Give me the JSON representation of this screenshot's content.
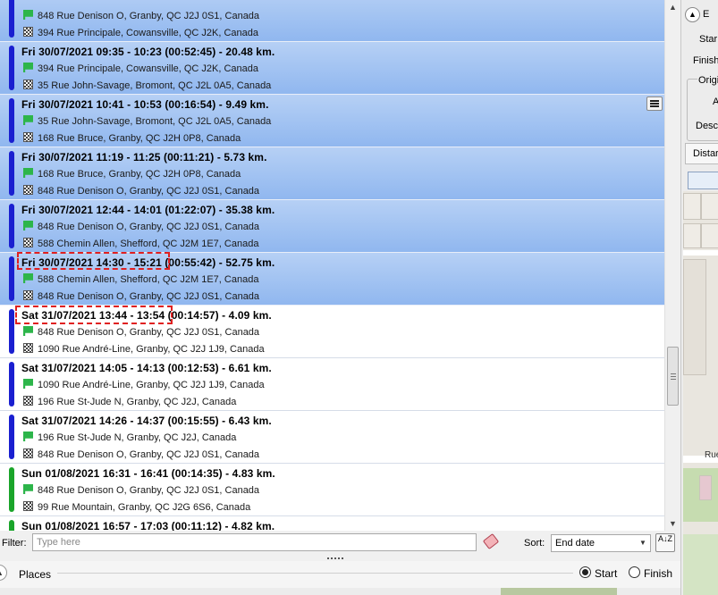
{
  "trips": [
    {
      "title": "",
      "from": "848 Rue Denison O, Granby, QC J2J 0S1, Canada",
      "to": "394 Rue Principale, Cowansville, QC J2K, Canada",
      "bar_color": "#1a1fd0",
      "selected": true
    },
    {
      "title": "Fri 30/07/2021  09:35 - 10:23  (00:52:45) - 20.48 km.",
      "from": "394 Rue Principale, Cowansville, QC J2K, Canada",
      "to": "35 Rue John-Savage, Bromont, QC J2L 0A5, Canada",
      "bar_color": "#1a1fd0",
      "selected": true
    },
    {
      "title": "Fri 30/07/2021  10:41 - 10:53  (00:16:54) - 9.49 km.",
      "from": "35 Rue John-Savage, Bromont, QC J2L 0A5, Canada",
      "to": "168 Rue Bruce, Granby, QC J2H 0P8, Canada",
      "bar_color": "#1a1fd0",
      "selected": true
    },
    {
      "title": "Fri 30/07/2021  11:19 - 11:25  (00:11:21) - 5.73 km.",
      "from": "168 Rue Bruce, Granby, QC J2H 0P8, Canada",
      "to": "848 Rue Denison O, Granby, QC J2J 0S1, Canada",
      "bar_color": "#1a1fd0",
      "selected": true
    },
    {
      "title": "Fri 30/07/2021  12:44 - 14:01  (01:22:07) - 35.38 km.",
      "from": "848 Rue Denison O, Granby, QC J2J 0S1, Canada",
      "to": "588 Chemin Allen, Shefford, QC J2M 1E7, Canada",
      "bar_color": "#1a1fd0",
      "selected": true
    },
    {
      "title": "Fri 30/07/2021  14:30 - 15:21  (00:55:42) - 52.75 km.",
      "from": "588 Chemin Allen, Shefford, QC J2M 1E7, Canada",
      "to": "848 Rue Denison O, Granby, QC J2J 0S1, Canada",
      "bar_color": "#1a1fd0",
      "selected": true
    },
    {
      "title": "Sat 31/07/2021  13:44 - 13:54  (00:14:57) - 4.09 km.",
      "from": "848 Rue Denison O, Granby, QC J2J 0S1, Canada",
      "to": "1090 Rue André-Line, Granby, QC J2J 1J9, Canada",
      "bar_color": "#1a1fd0",
      "selected": false
    },
    {
      "title": "Sat 31/07/2021  14:05 - 14:13  (00:12:53) - 6.61 km.",
      "from": "1090 Rue André-Line, Granby, QC J2J 1J9, Canada",
      "to": "196 Rue St-Jude N, Granby, QC J2J, Canada",
      "bar_color": "#1a1fd0",
      "selected": false
    },
    {
      "title": "Sat 31/07/2021  14:26 - 14:37  (00:15:55) - 6.43 km.",
      "from": "196 Rue St-Jude N, Granby, QC J2J, Canada",
      "to": "848 Rue Denison O, Granby, QC J2J 0S1, Canada",
      "bar_color": "#1a1fd0",
      "selected": false
    },
    {
      "title": "Sun 01/08/2021  16:31 - 16:41  (00:14:35) - 4.83 km.",
      "from": "848 Rue Denison O, Granby, QC J2J 0S1, Canada",
      "to": "99 Rue Mountain, Granby, QC J2G 6S6, Canada",
      "bar_color": "#1aa52a",
      "selected": false
    },
    {
      "title": "Sun 01/08/2021  16:57 - 17:03  (00:11:12) - 4.82 km.",
      "from": "",
      "to": "",
      "bar_color": "#1aa52a",
      "selected": false
    }
  ],
  "filter": {
    "label": "Filter:",
    "placeholder": "Type here",
    "value": ""
  },
  "sort": {
    "label": "Sort:",
    "value": "End date",
    "dir_glyph": "A↓Z"
  },
  "places": {
    "label": "Places",
    "start_label": "Start",
    "finish_label": "Finish",
    "selected": "Start"
  },
  "right_panel": {
    "tab_label": "E",
    "start_label": "Star",
    "finish_label": "Finish",
    "origin_label": "Origi",
    "a_label": "A",
    "desc_label": "Desc",
    "distance_label": "Distar",
    "map_street_label": "Rue"
  },
  "colors": {
    "selected_row": "#a3c4f3",
    "start_flag": "#2db54a",
    "highlight": "#e02020"
  }
}
